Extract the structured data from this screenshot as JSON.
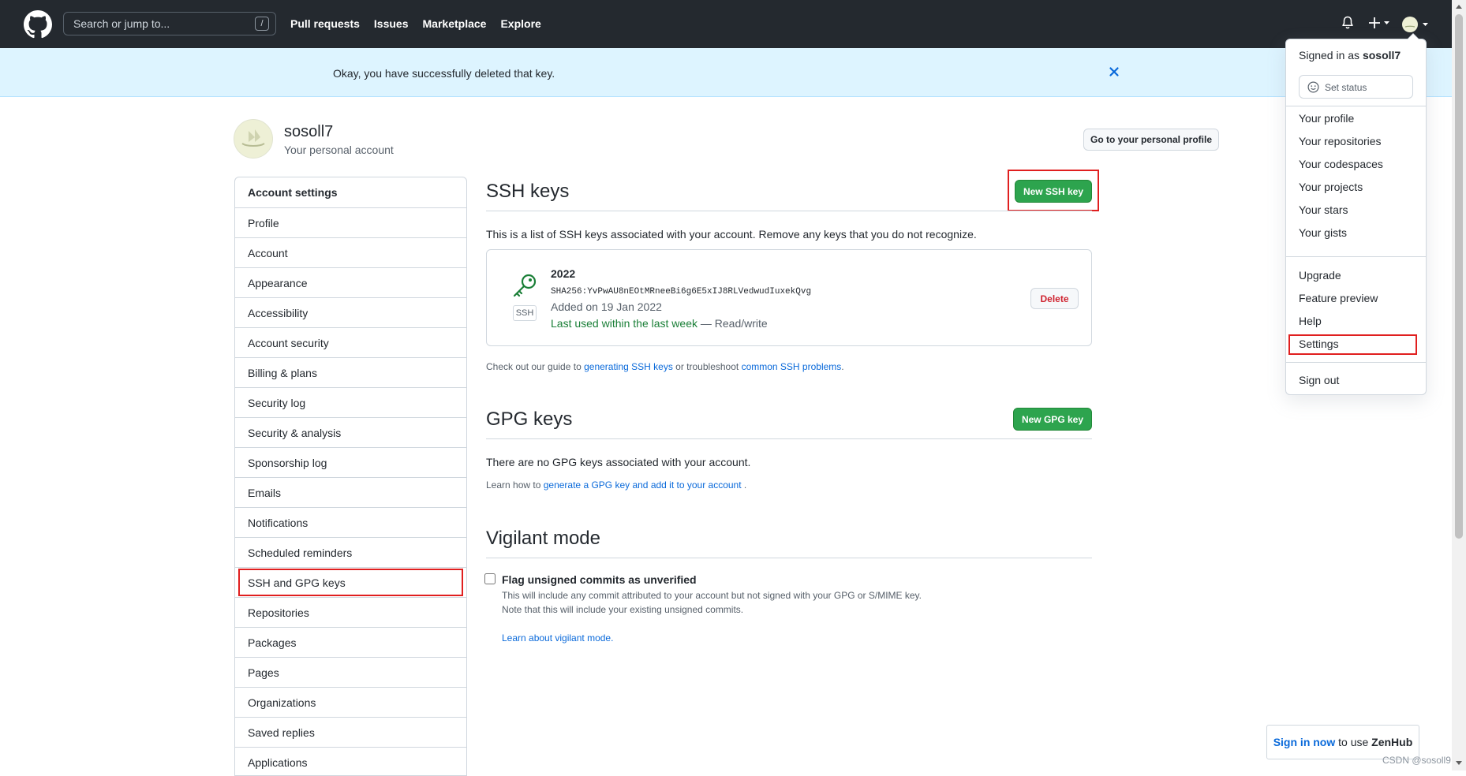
{
  "header": {
    "search_placeholder": "Search or jump to...",
    "search_key": "/",
    "nav": [
      "Pull requests",
      "Issues",
      "Marketplace",
      "Explore"
    ]
  },
  "flash": {
    "message": "Okay, you have successfully deleted that key."
  },
  "account": {
    "username": "sosoll7",
    "subtitle": "Your personal account",
    "profile_button": "Go to your personal profile"
  },
  "sidebar": {
    "heading": "Account settings",
    "items": [
      "Profile",
      "Account",
      "Appearance",
      "Accessibility",
      "Account security",
      "Billing & plans",
      "Security log",
      "Security & analysis",
      "Sponsorship log",
      "Emails",
      "Notifications",
      "Scheduled reminders",
      "SSH and GPG keys",
      "Repositories",
      "Packages",
      "Pages",
      "Organizations",
      "Saved replies",
      "Applications"
    ],
    "active": "SSH and GPG keys"
  },
  "ssh": {
    "title": "SSH keys",
    "new_button": "New SSH key",
    "description": "This is a list of SSH keys associated with your account. Remove any keys that you do not recognize.",
    "key": {
      "name": "2022",
      "fingerprint": "SHA256:YvPwAU8nEOtMRneeBi6g6E5xIJ8RLVedwudIuxekQvg",
      "added": "Added on 19 Jan 2022",
      "last_used": "Last used within the last week",
      "access": "— Read/write",
      "badge": "SSH",
      "delete_button": "Delete"
    },
    "guide_prefix": "Check out our guide to",
    "guide_link1": "generating SSH keys",
    "guide_mid": "or troubleshoot",
    "guide_link2": "common SSH problems",
    "guide_suffix": "."
  },
  "gpg": {
    "title": "GPG keys",
    "new_button": "New GPG key",
    "empty": "There are no GPG keys associated with your account.",
    "learn_prefix": "Learn how to",
    "learn_link": "generate a GPG key and add it to your account",
    "learn_suffix": "."
  },
  "vigilant": {
    "title": "Vigilant mode",
    "checkbox_label": "Flag unsigned commits as unverified",
    "checked": false,
    "desc1": "This will include any commit attributed to your account but not signed with your GPG or S/MIME key.",
    "desc2": "Note that this will include your existing unsigned commits.",
    "learn_link": "Learn about vigilant mode."
  },
  "dropdown": {
    "signed_in_prefix": "Signed in as",
    "signed_in_user": "sosoll7",
    "set_status": "Set status",
    "group1": [
      "Your profile",
      "Your repositories",
      "Your codespaces",
      "Your projects",
      "Your stars",
      "Your gists"
    ],
    "group2": [
      "Upgrade",
      "Feature preview",
      "Help",
      "Settings"
    ],
    "sign_out": "Sign out"
  },
  "zenhub": {
    "link": "Sign in now",
    "middle": "to use",
    "brand": "ZenHub"
  },
  "watermark": "CSDN @sosoll9",
  "colors": {
    "header_bg": "#24292f",
    "flash_bg": "#ddf4ff",
    "green": "#2da44e",
    "link": "#0969da",
    "danger": "#cf222e",
    "highlight": "#e01f1f"
  }
}
